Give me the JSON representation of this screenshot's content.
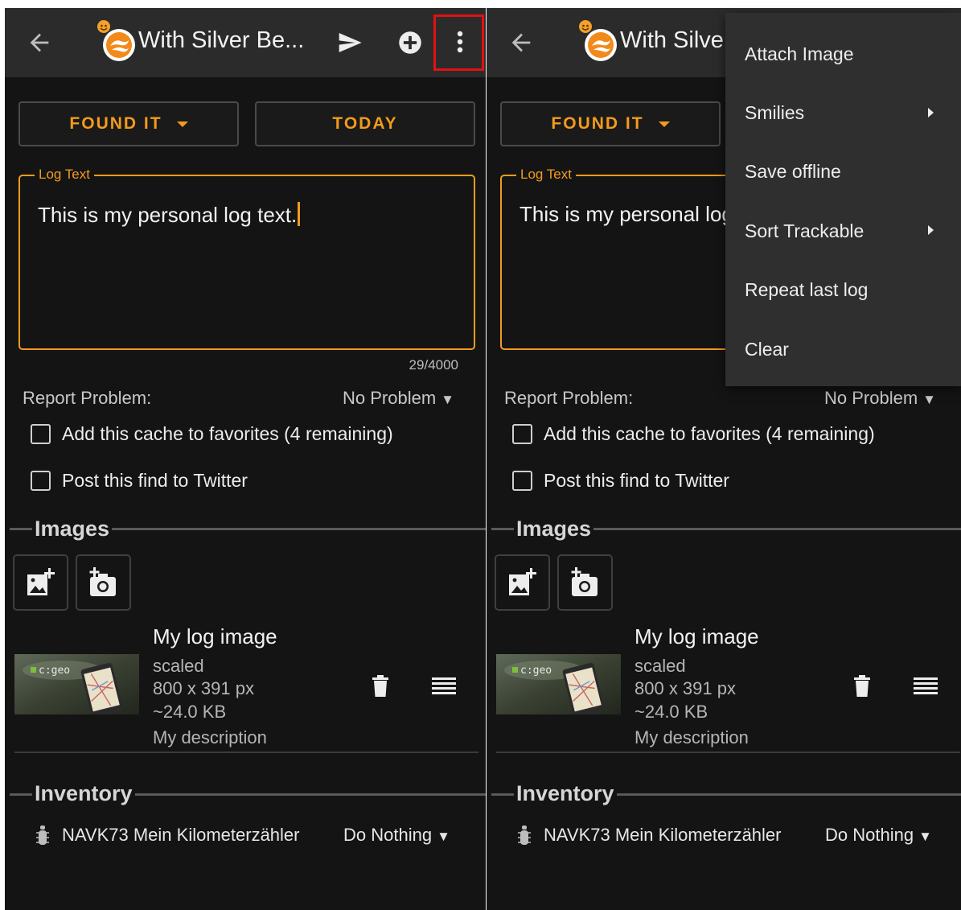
{
  "screen": {
    "title": "With Silver Be...",
    "found_label": "FOUND IT",
    "date_label": "TODAY",
    "log_label": "Log Text",
    "log_text": "This is my personal log text.",
    "counter": "29/4000",
    "report_label": "Report Problem:",
    "report_value": "No Problem",
    "favorites_label": "Add this cache to favorites (4 remaining)",
    "twitter_label": "Post this find to Twitter",
    "images_title": "Images",
    "thumb_logo": "c:geo",
    "image": {
      "name": "My log image",
      "scale": "scaled",
      "dimensions": "800 x 391 px",
      "size": "~24.0 KB",
      "description": "My description"
    },
    "inventory_title": "Inventory",
    "trackable": {
      "name": "NAVK73 Mein Kilometerzähler",
      "action": "Do Nothing"
    }
  },
  "screen_right": {
    "title": "With Silve"
  },
  "menu": {
    "attach_image": "Attach Image",
    "smilies": "Smilies",
    "save_offline": "Save offline",
    "sort_trackable": "Sort Trackable",
    "repeat_last_log": "Repeat last log",
    "clear": "Clear"
  },
  "symbols": {
    "dropdown_triangle": "▼"
  },
  "icons": {
    "back": "arrow-left-icon",
    "cache": "cache-type-icon",
    "send": "send-icon",
    "add": "add-circle-icon",
    "more": "more-vertical-icon",
    "gallery": "add-photo-icon",
    "camera": "add-camera-icon",
    "delete": "trash-icon",
    "reorder": "reorder-icon",
    "trackable": "trackable-bug-icon"
  },
  "colors": {
    "accent": "#f29b1c",
    "background": "#141414",
    "toolbar": "#2b2b2b",
    "highlight": "#e01212",
    "menu": "#2f2f2f"
  }
}
